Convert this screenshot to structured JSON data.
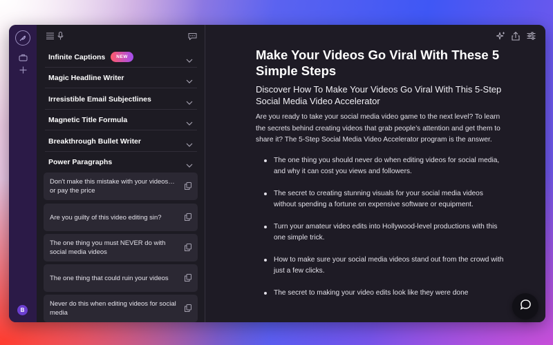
{
  "rail": {
    "avatar_initial": "B",
    "icons": [
      "feather-logo-icon",
      "briefcase-icon",
      "plus-icon"
    ]
  },
  "panel": {
    "top_icons": [
      "list-icon",
      "microphone-icon",
      "chat-bubble-icon"
    ],
    "sections": [
      {
        "label": "Infinite Captions",
        "badge": "NEW"
      },
      {
        "label": "Magic Headline Writer"
      },
      {
        "label": "Irresistible Email Subjectlines"
      },
      {
        "label": "Magnetic Title Formula"
      },
      {
        "label": "Breakthrough Bullet Writer"
      },
      {
        "label": "Power Paragraphs"
      }
    ],
    "cards": [
      "Don't make this mistake with your videos… or pay the price",
      "Are you guilty of this video editing sin?",
      "The one thing you must NEVER do with social media videos",
      "The one thing that could ruin your videos",
      "Never do this when editing videos for social media"
    ]
  },
  "toolbar": {
    "icons": [
      "sparkle-icon",
      "share-icon",
      "sliders-icon"
    ]
  },
  "document": {
    "title": "Make Your Videos Go Viral With These 5 Simple Steps",
    "subtitle": "Discover How To Make Your Videos Go Viral With This 5-Step Social Media Video Accelerator",
    "intro": "Are you ready to take your social media video game to the next level? To learn the secrets behind creating videos that grab people’s attention and get them to share it? The 5-Step Social Media Video Accelerator program is the answer.",
    "bullets": [
      "The one thing you should never do when editing videos for social media, and why it can cost you views and followers.",
      "The secret to creating stunning visuals for your social media videos without spending a fortune on expensive software or equipment.",
      "Turn your amateur video edits into Hollywood-level productions with this one simple trick.",
      "How to make sure your social media videos stand out from the crowd with just a few clicks.",
      "The secret to making your video edits look like they were done"
    ]
  },
  "colors": {
    "rail_bg": "#2b1a47",
    "panel_bg": "#1d1b23",
    "content_bg": "#1e1b25",
    "badge_gradient_start": "#ff5a6a",
    "badge_gradient_end": "#a24ef0"
  }
}
